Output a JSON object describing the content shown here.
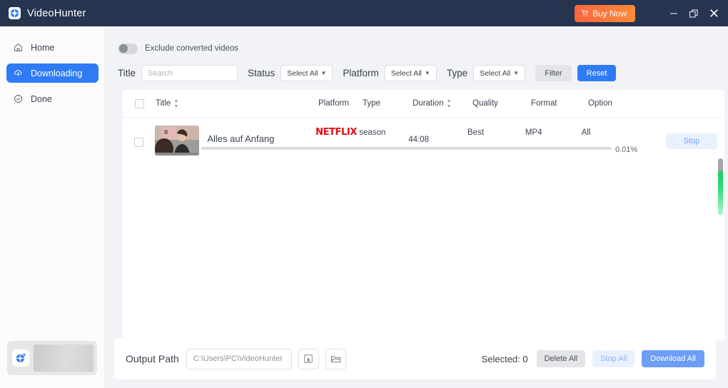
{
  "titlebar": {
    "app_name": "VideoHunter",
    "logo_icon": "videohunter-logo-icon",
    "buy_label": "Buy Now",
    "cart_icon": "cart-icon",
    "menu_icon": "hamburger-menu-icon",
    "minimize_icon": "minimize-icon",
    "maximize_icon": "restore-icon",
    "close_icon": "close-icon",
    "brand_color": "#26344f",
    "buy_color_start": "#f8663d",
    "buy_color_end": "#fb8b3a"
  },
  "sidebar": {
    "items": [
      {
        "label": "Home",
        "icon": "home-icon",
        "active": false
      },
      {
        "label": "Downloading",
        "icon": "download-cloud-icon",
        "active": true
      },
      {
        "label": "Done",
        "icon": "check-circle-icon",
        "active": false
      }
    ],
    "active_color": "#2f7bf6",
    "ad_card": {
      "icon": "app-badge-icon"
    }
  },
  "toolbar": {
    "exclude_toggle": {
      "label": "Exclude converted videos",
      "state": "off"
    },
    "title_label": "Title",
    "search": {
      "placeholder": "Search",
      "value": ""
    },
    "status_label": "Status",
    "status_select": "Select All",
    "platform_label": "Platform",
    "platform_select": "Select All",
    "type_label": "Type",
    "type_select": "Select All",
    "filter_label": "Filter",
    "reset_label": "Reset",
    "reset_color": "#2f7bf6"
  },
  "table": {
    "columns": {
      "title": "Title",
      "platform": "Platform",
      "type": "Type",
      "duration": "Duration",
      "quality": "Quality",
      "format": "Format",
      "option": "Option"
    },
    "sortable": [
      "Title",
      "Duration"
    ],
    "rows": [
      {
        "title": "Alles auf Anfang",
        "platform": "NETFLIX",
        "platform_color": "#e50914",
        "type": "season",
        "duration": "44:08",
        "quality": "Best",
        "format": "MP4",
        "option": "All",
        "action_label": "Stop",
        "progress_pct": "0.01%",
        "progress_value": 0.01
      }
    ],
    "scrollbar_color": "#19cf63"
  },
  "bottombar": {
    "output_label": "Output Path",
    "path_value": "C:\\Users\\PC\\VideoHunter",
    "cursor_icon": "pointer-box-icon",
    "folder_icon": "folder-open-icon",
    "selected_label": "Selected: 0",
    "delete_all_label": "Delete All",
    "stop_all_label": "Stop All",
    "download_all_label": "Download All",
    "download_all_color": "#6e9df6"
  }
}
